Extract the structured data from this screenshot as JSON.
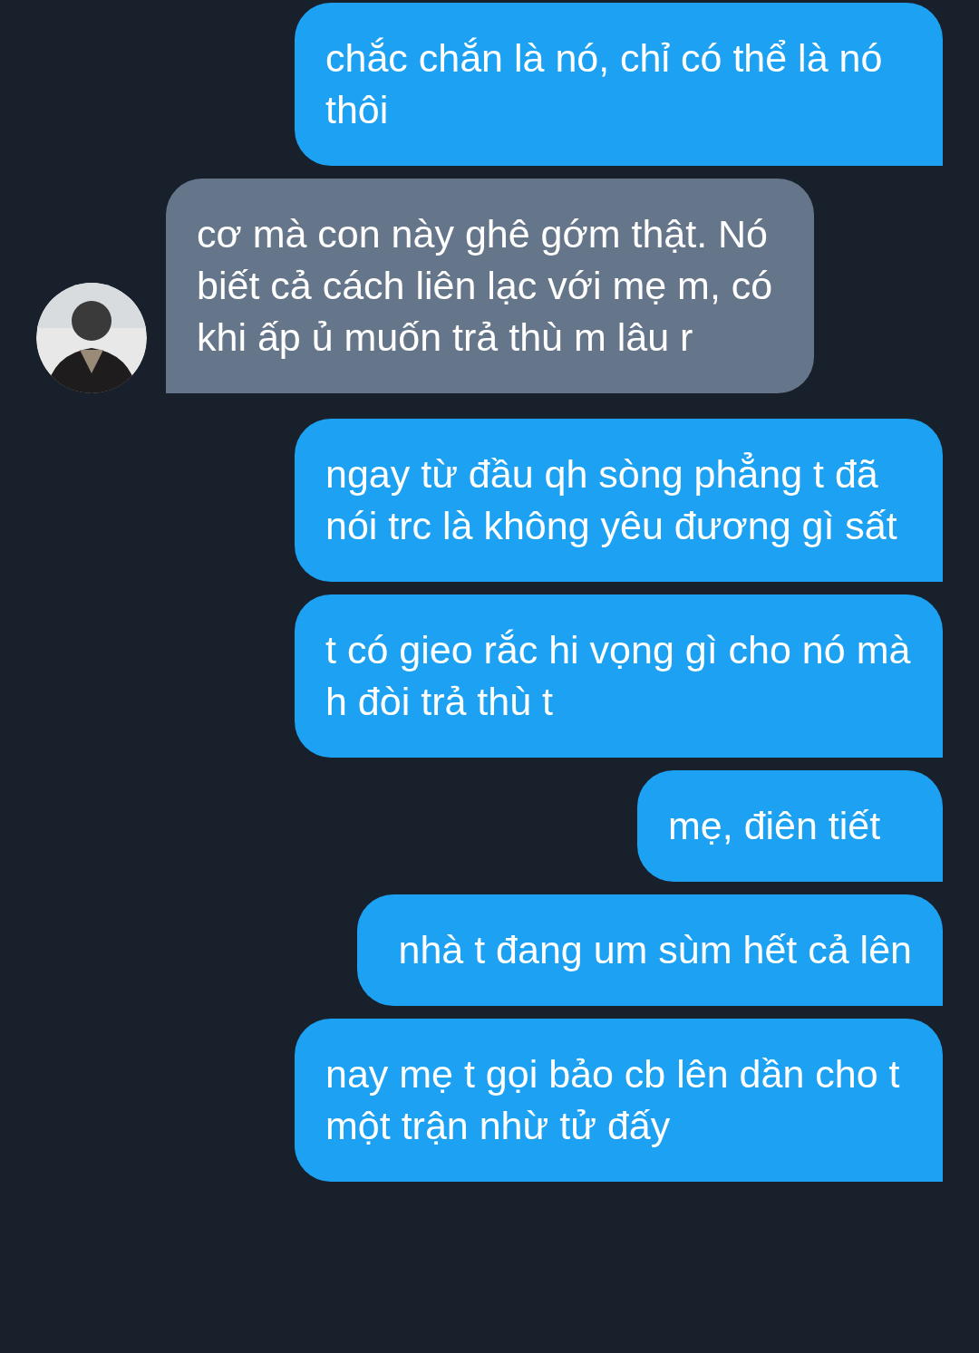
{
  "messages": [
    {
      "kind": "sent",
      "text": "chắc chắn là nó, chỉ có thể là nó thôi"
    },
    {
      "kind": "received",
      "text": "cơ mà con này ghê gớm thật. Nó biết cả cách liên lạc với mẹ m, có khi ấp ủ muốn trả thù m lâu r"
    },
    {
      "kind": "sent",
      "text": "ngay từ đầu qh sòng phẳng t đã nói trc là không yêu đương gì sất"
    },
    {
      "kind": "sent",
      "text": "t có gieo rắc hi vọng gì cho nó mà h đòi trả thù t"
    },
    {
      "kind": "sent",
      "text": "mẹ, điên tiết"
    },
    {
      "kind": "sent",
      "text": " nhà t đang um sùm hết cả lên"
    },
    {
      "kind": "sent",
      "text": "nay mẹ t gọi bảo cb lên dần cho t một trận nhừ tử đấy"
    }
  ]
}
